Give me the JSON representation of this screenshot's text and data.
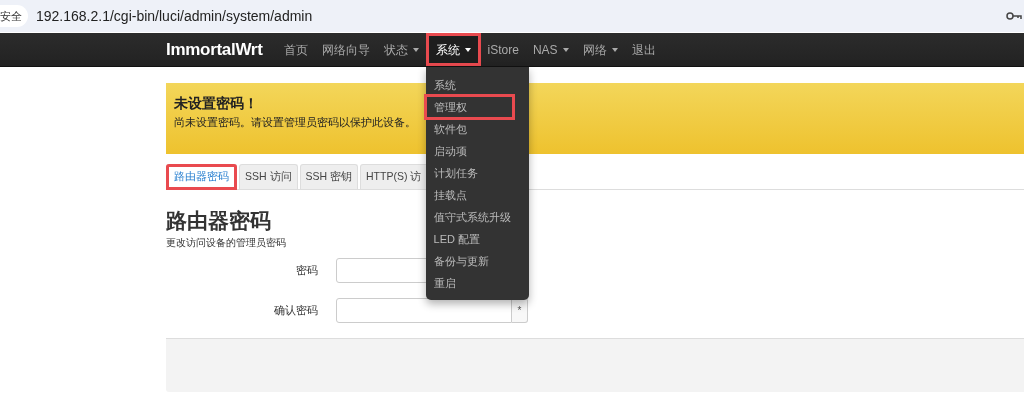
{
  "address_bar": {
    "security_label": "安全",
    "url": "192.168.2.1/cgi-bin/luci/admin/system/admin"
  },
  "navbar": {
    "brand": "ImmortalWrt",
    "items": [
      {
        "label": "首页",
        "dropdown": false,
        "selected": false,
        "highlighted": false
      },
      {
        "label": "网络向导",
        "dropdown": false,
        "selected": false,
        "highlighted": false
      },
      {
        "label": "状态",
        "dropdown": true,
        "selected": false,
        "highlighted": false
      },
      {
        "label": "系统",
        "dropdown": true,
        "selected": true,
        "highlighted": true
      },
      {
        "label": "iStore",
        "dropdown": false,
        "selected": false,
        "highlighted": false
      },
      {
        "label": "NAS",
        "dropdown": true,
        "selected": false,
        "highlighted": false
      },
      {
        "label": "网络",
        "dropdown": true,
        "selected": false,
        "highlighted": false
      },
      {
        "label": "退出",
        "dropdown": false,
        "selected": false,
        "highlighted": false
      }
    ]
  },
  "dropdown_menu": {
    "items": [
      {
        "label": "系统",
        "highlighted": false
      },
      {
        "label": "管理权",
        "highlighted": true
      },
      {
        "label": "软件包",
        "highlighted": false
      },
      {
        "label": "启动项",
        "highlighted": false
      },
      {
        "label": "计划任务",
        "highlighted": false
      },
      {
        "label": "挂载点",
        "highlighted": false
      },
      {
        "label": "值守式系统升级",
        "highlighted": false
      },
      {
        "label": "LED 配置",
        "highlighted": false
      },
      {
        "label": "备份与更新",
        "highlighted": false
      },
      {
        "label": "重启",
        "highlighted": false
      }
    ]
  },
  "alert": {
    "title": "未设置密码！",
    "message": "尚未设置密码。请设置管理员密码以保护此设备。"
  },
  "tabs": [
    {
      "label": "路由器密码",
      "selected": true,
      "highlighted": true
    },
    {
      "label": "SSH 访问",
      "selected": false,
      "highlighted": false
    },
    {
      "label": "SSH 密钥",
      "selected": false,
      "highlighted": false
    },
    {
      "label": "HTTP(S) 访",
      "selected": false,
      "highlighted": false
    }
  ],
  "section": {
    "title": "路由器密码",
    "description": "更改访问设备的管理员密码"
  },
  "fields": [
    {
      "label": "密码"
    },
    {
      "label": "确认密码",
      "reveal_button": "*"
    }
  ]
}
